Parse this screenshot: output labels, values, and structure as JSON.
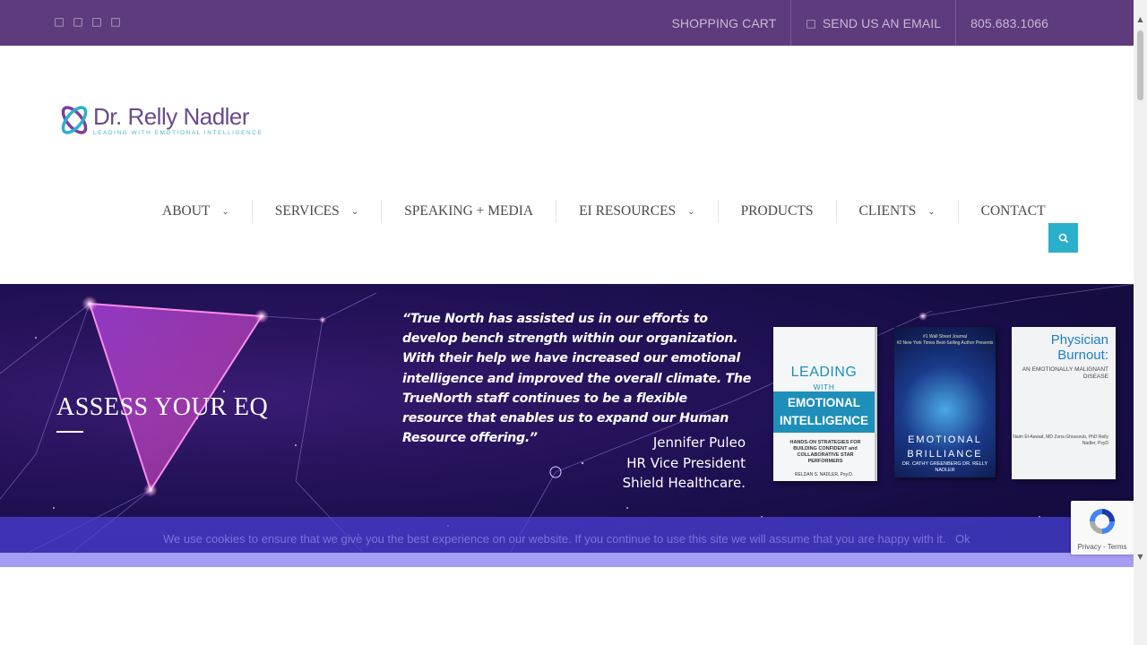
{
  "topbar": {
    "social_icons": [
      "facebook-icon",
      "twitter-icon",
      "linkedin-icon",
      "youtube-icon"
    ],
    "shopping_cart": "SHOPPING CART",
    "email_label": "SEND US AN EMAIL",
    "phone": "805.683.1066"
  },
  "logo": {
    "name": "Dr. Relly Nadler",
    "tagline": "LEADING WITH EMOTIONAL INTELLIGENCE"
  },
  "nav": {
    "items": [
      {
        "label": "ABOUT",
        "has_dropdown": true
      },
      {
        "label": "SERVICES",
        "has_dropdown": true
      },
      {
        "label": "SPEAKING + MEDIA",
        "has_dropdown": false
      },
      {
        "label": "EI RESOURCES",
        "has_dropdown": true
      },
      {
        "label": "PRODUCTS",
        "has_dropdown": false
      },
      {
        "label": "CLIENTS",
        "has_dropdown": true
      },
      {
        "label": "CONTACT",
        "has_dropdown": false
      }
    ]
  },
  "hero": {
    "heading": "ASSESS YOUR EQ",
    "quote": "“True North has assisted us in our efforts to develop bench strength within our organization. With their help we have increased our emotional intelligence and improved the overall climate. The TrueNorth staff continues to be a flexible resource that enables us to expand our Human Resource offering.”",
    "attribution_name": "Jennifer Puleo",
    "attribution_title": "HR Vice President",
    "attribution_company": "Shield Healthcare.",
    "books": [
      {
        "title_top": "LEADING",
        "title_mid": "WITH",
        "title_main": "EMOTIONAL INTELLIGENCE",
        "subtitle": "HANDS-ON STRATEGIES FOR BUILDING CONFIDENT and COLLABORATIVE STAR PERFORMERS",
        "author": "RELDAN S. NADLER, Psy.D."
      },
      {
        "top_line_1": "#1 Wall Street Journal",
        "top_line_2": "#2 New York Times Best-Selling Author Presents",
        "title": "EMOTIONAL BRILLIANCE",
        "authors": "DR. CATHY GREENBERG   DR. RELLY NADLER"
      },
      {
        "title_1": "Physician",
        "title_2": "Burnout:",
        "subtitle": "AN EMOTIONALLY MALIGNANT DISEASE",
        "authors": "Naim El-Aswad, MD Zona Ghossoub, PhD Relly Nadler, PsyD"
      }
    ]
  },
  "cookie": {
    "message": "We use cookies to ensure that we give you the best experience on our website. If you continue to use this site we will assume that you are happy with it.",
    "ok": "Ok"
  },
  "recaptcha": {
    "links": "Privacy - Terms"
  },
  "colors": {
    "topbar": "#5e3b7c",
    "topbar_text": "#c9b8da",
    "accent_teal": "#2bb0cc",
    "hero_bg": "#170d45",
    "cookie_bg": "#4942dc"
  }
}
